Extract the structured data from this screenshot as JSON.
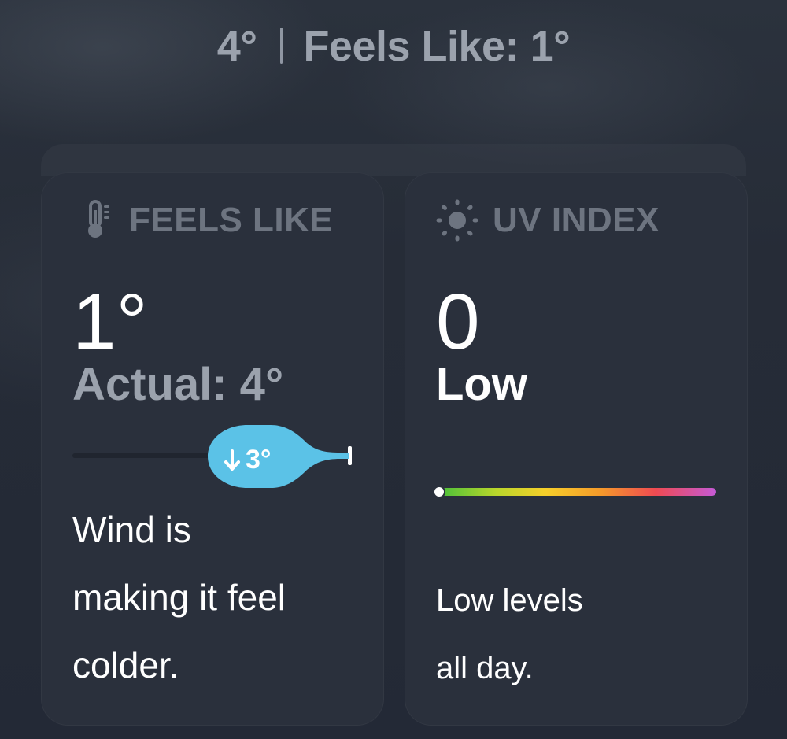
{
  "header": {
    "temperature": "4°",
    "feels_like": "Feels Like: 1°"
  },
  "feels_like_card": {
    "title": "FEELS LIKE",
    "icon": "thermometer-icon",
    "value": "1°",
    "actual": "Actual: 4°",
    "difference_label": "3°",
    "difference_icon": "arrow-down-icon",
    "description_lines": [
      "Wind is",
      "making it feel",
      "colder."
    ],
    "accent_color": "#5bc2e7"
  },
  "uv_card": {
    "title": "UV INDEX",
    "icon": "sun-icon",
    "value": "0",
    "level": "Low",
    "scale_position": 0,
    "description_lines": [
      "Low levels",
      "all day."
    ]
  }
}
